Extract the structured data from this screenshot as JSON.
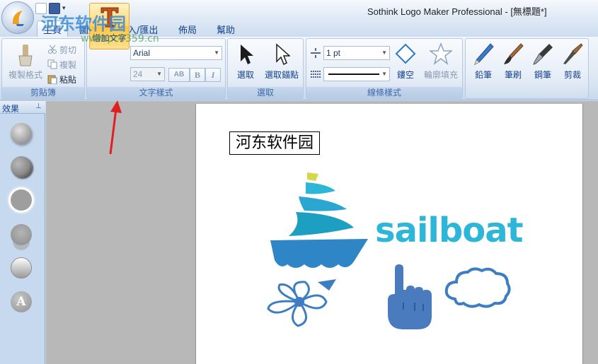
{
  "window": {
    "title": "Sothink Logo Maker Professional - [無標題*]"
  },
  "quick_access": {
    "more": "▾"
  },
  "tabs": [
    {
      "label": "主頁",
      "active": true
    },
    {
      "label": "圖層",
      "active": false
    },
    {
      "label": "匯入/匯出",
      "active": false
    },
    {
      "label": "佈局",
      "active": false
    },
    {
      "label": "幫助",
      "active": false
    }
  ],
  "ribbon": {
    "clipboard": {
      "label": "剪貼簿",
      "copy_format": "複製格式",
      "cut": "剪切",
      "copy": "複製",
      "paste": "粘貼"
    },
    "text_style": {
      "label": "文字樣式",
      "add_text": "增加文字",
      "font": "Arial",
      "size": "24",
      "bold": "B",
      "italic": "I",
      "spacing": "AB"
    },
    "select": {
      "label": "選取",
      "select": "選取",
      "select_anchor": "選取錨點"
    },
    "line_style": {
      "label": "線條樣式",
      "width": "1 pt",
      "hollow": "鏤空",
      "outline_fill": "輪廓填充"
    },
    "tools": {
      "pencil": "鉛筆",
      "brush": "筆刷",
      "pen": "鋼筆",
      "cut": "剪裁"
    }
  },
  "side_panel": {
    "title": "效果",
    "pin": "⊥",
    "effect_text_label": "A"
  },
  "canvas": {
    "textbox": "河东软件园",
    "logo_word": "sailboat"
  },
  "watermark": {
    "title": "河东软件园",
    "url": "www.pc0359.cn"
  },
  "colors": {
    "logo_teal": "#2db6d8",
    "logo_blue": "#2f86c6",
    "logo_dark_blue": "#3c7ec1",
    "logo_yellow": "#d3d84a",
    "logo_hand": "#4a7bbf",
    "annotation_arrow": "#e02020",
    "ribbon_highlight": "#ffd46a"
  }
}
